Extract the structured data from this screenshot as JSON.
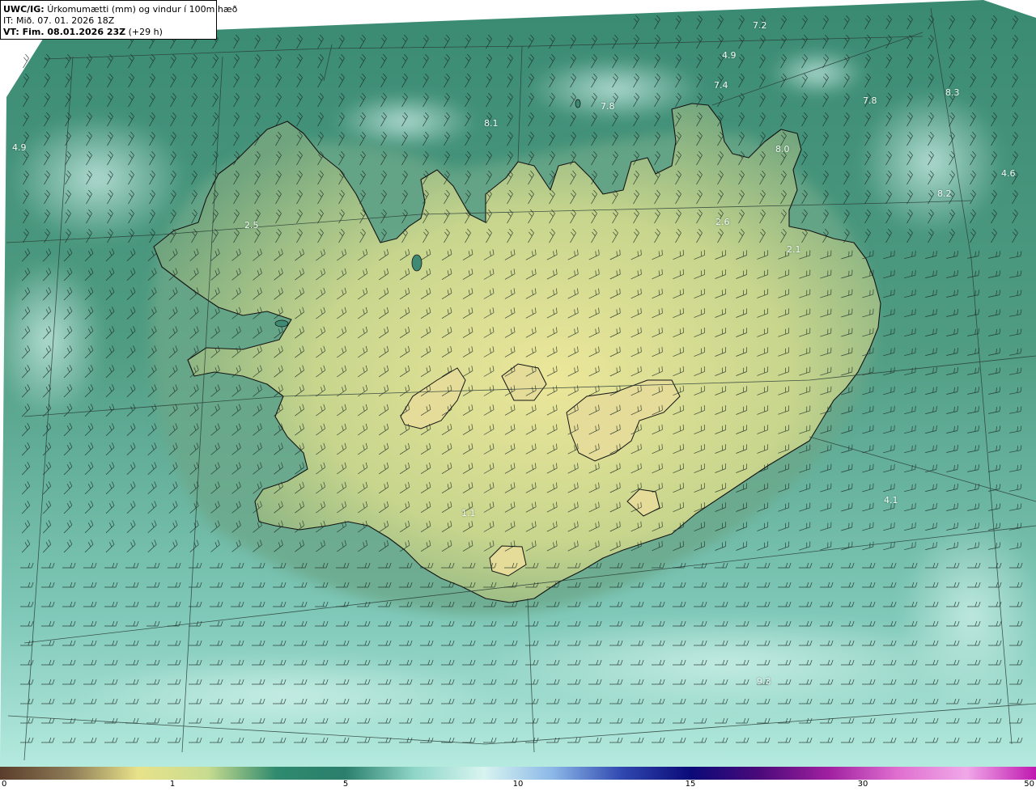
{
  "header": {
    "model": "UWC/IG:",
    "product": "Úrkomumætti (mm) og vindur í 100m hæð",
    "init_time": "IT: Mið. 07. 01. 2026 18Z",
    "valid_label": "VT: Fim. 08.01.2026 23Z",
    "lead": "(+29 h)"
  },
  "map_values": [
    "7.2",
    "4.9",
    "7.4",
    "7.8",
    "7.8",
    "8.3",
    "4.9",
    "8.1",
    "8.0",
    "4.6",
    "8.2",
    "2.5",
    "2.6",
    "2.1",
    "4.1",
    "1.1",
    "9.3"
  ],
  "colorbar": {
    "ticks": [
      "0",
      "1",
      "5",
      "10",
      "15",
      "30",
      "50"
    ],
    "colors": [
      "#5a3d2b",
      "#8c7a55",
      "#e8e28a",
      "#c8dc90",
      "#2f8a6e",
      "#2b7f6c",
      "#8fd6c8",
      "#d8f4f0",
      "#8cb8e8",
      "#3048b0",
      "#0a0a78",
      "#4b0a7a",
      "#a020a0",
      "#e070d0",
      "#f0a8e8",
      "#c018b0"
    ]
  },
  "colors": {
    "sea_deep": "#2c7a64",
    "sea_light": "#a8e3d6",
    "land_low": "#5f9e76",
    "land_high": "#e3e196",
    "coast": "#111111"
  }
}
